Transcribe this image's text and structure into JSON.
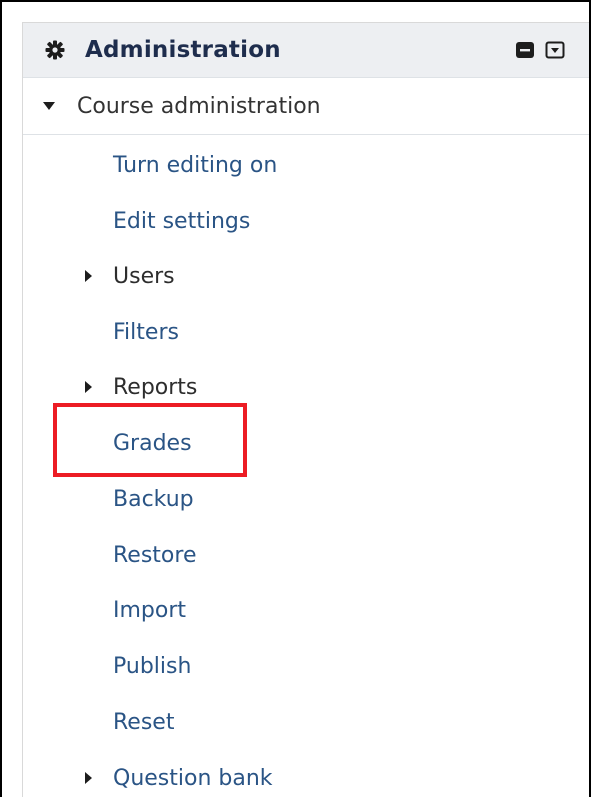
{
  "block": {
    "title": "Administration",
    "icon": "gear-icon",
    "controls": [
      "minus-box-icon",
      "dropdown-box-icon"
    ]
  },
  "course_admin": {
    "label": "Course administration",
    "expanded": true
  },
  "items": [
    {
      "label": "Turn editing on",
      "type": "link"
    },
    {
      "label": "Edit settings",
      "type": "link"
    },
    {
      "label": "Users",
      "type": "branch"
    },
    {
      "label": "Filters",
      "type": "link"
    },
    {
      "label": "Reports",
      "type": "branch"
    },
    {
      "label": "Grades",
      "type": "link",
      "highlighted": true
    },
    {
      "label": "Backup",
      "type": "link"
    },
    {
      "label": "Restore",
      "type": "link"
    },
    {
      "label": "Import",
      "type": "link"
    },
    {
      "label": "Publish",
      "type": "link"
    },
    {
      "label": "Reset",
      "type": "link"
    },
    {
      "label": "Question bank",
      "type": "branch"
    }
  ],
  "colors": {
    "link": "#2a5485",
    "header_bg": "#edeff2",
    "title": "#1e2d4d",
    "highlight": "#ec1c24"
  }
}
